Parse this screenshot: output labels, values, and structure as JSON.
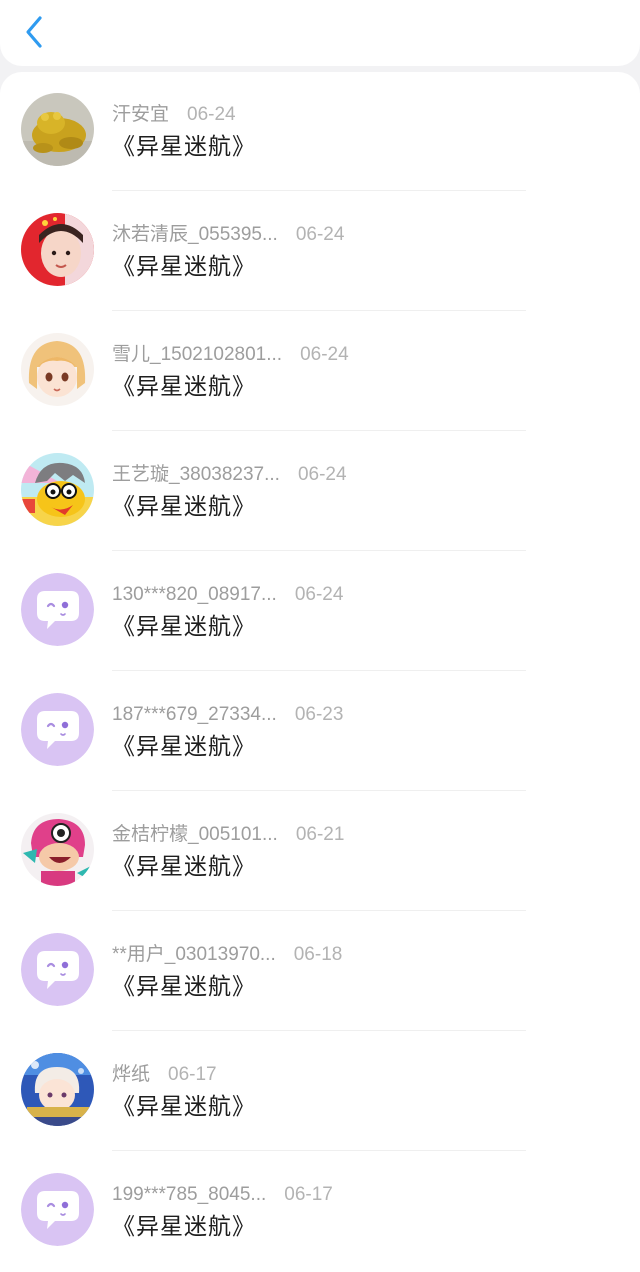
{
  "header": {
    "back_icon": "chevron-left-icon",
    "accent": "#2f9bf0"
  },
  "items": [
    {
      "name": "汗安宜",
      "date": "06-24",
      "title": "《异星迷航》",
      "avatar": "golden-frog-avatar"
    },
    {
      "name": "沐若清辰_055395...",
      "date": "06-24",
      "title": "《异星迷航》",
      "avatar": "child-photo-avatar"
    },
    {
      "name": "雪儿_1502102801...",
      "date": "06-24",
      "title": "《异星迷航》",
      "avatar": "anime-girl-avatar"
    },
    {
      "name": "王艺璇_38038237...",
      "date": "06-24",
      "title": "《异星迷航》",
      "avatar": "cartoon-bird-avatar"
    },
    {
      "name": "130***820_08917...",
      "date": "06-24",
      "title": "《异星迷航》",
      "avatar": "default-chat-avatar"
    },
    {
      "name": "187***679_27334...",
      "date": "06-23",
      "title": "《异星迷航》",
      "avatar": "default-chat-avatar"
    },
    {
      "name": "金桔柠檬_005101...",
      "date": "06-21",
      "title": "《异星迷航》",
      "avatar": "pink-monster-avatar"
    },
    {
      "name": "**用户_03013970...",
      "date": "06-18",
      "title": "《异星迷航》",
      "avatar": "default-chat-avatar"
    },
    {
      "name": "烨纸",
      "date": "06-17",
      "title": "《异星迷航》",
      "avatar": "chibi-character-avatar"
    },
    {
      "name": "199***785_8045...",
      "date": "06-17",
      "title": "《异星迷航》",
      "avatar": "default-chat-avatar"
    }
  ]
}
